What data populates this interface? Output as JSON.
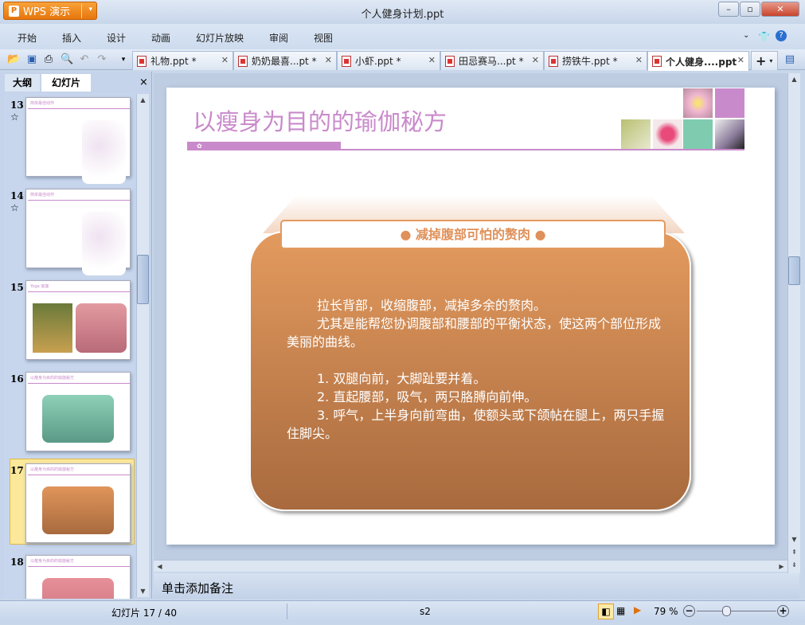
{
  "app": {
    "name": "WPS 演示",
    "window_title": "个人健身计划.ppt"
  },
  "menu": [
    "开始",
    "插入",
    "设计",
    "动画",
    "幻灯片放映",
    "审阅",
    "视图"
  ],
  "tabs": [
    {
      "label": "礼物.ppt *"
    },
    {
      "label": "奶奶最喜...pt *"
    },
    {
      "label": "小虾.ppt *"
    },
    {
      "label": "田忌赛马...pt *"
    },
    {
      "label": "捞铁牛.ppt *"
    },
    {
      "label": "个人健身....ppt"
    }
  ],
  "left_pane": {
    "tabs": [
      "大纲",
      "幻灯片"
    ],
    "close": "×",
    "thumbs": [
      {
        "num": "13",
        "title": "简单最佳动作",
        "star": "☆"
      },
      {
        "num": "14",
        "title": "简单最佳动作",
        "star": "☆"
      },
      {
        "num": "15",
        "title": "Yoga 瑜伽"
      },
      {
        "num": "16",
        "title": "以瘦身为目的的瑜伽秘方"
      },
      {
        "num": "17",
        "title": "以瘦身为目的的瑜伽秘方"
      },
      {
        "num": "18",
        "title": "以瘦身为目的的瑜伽秘方"
      }
    ]
  },
  "slide": {
    "title": "以瘦身为目的的瑜伽秘方",
    "box_header": "减掉腹部可怕的赘肉",
    "paragraphs": [
      "拉长背部，收缩腹部，减掉多余的赘肉。",
      "尤其是能帮您协调腹部和腰部的平衡状态，使这两个部位形成美丽的曲线。"
    ],
    "steps": [
      "1. 双腿向前，大脚趾要并着。",
      "2. 直起腰部，吸气，两只胳膊向前伸。",
      "3. 呼气，上半身向前弯曲，使额头或下颌帖在腿上，两只手握住脚尖。"
    ]
  },
  "notes_placeholder": "单击添加备注",
  "status": {
    "slide_pos": "幻灯片 17 / 40",
    "theme": "s2",
    "zoom": "79 %"
  },
  "colors": {
    "accent": "#c98acb",
    "box": "#d98c55",
    "teal": "#7ecbb0"
  }
}
